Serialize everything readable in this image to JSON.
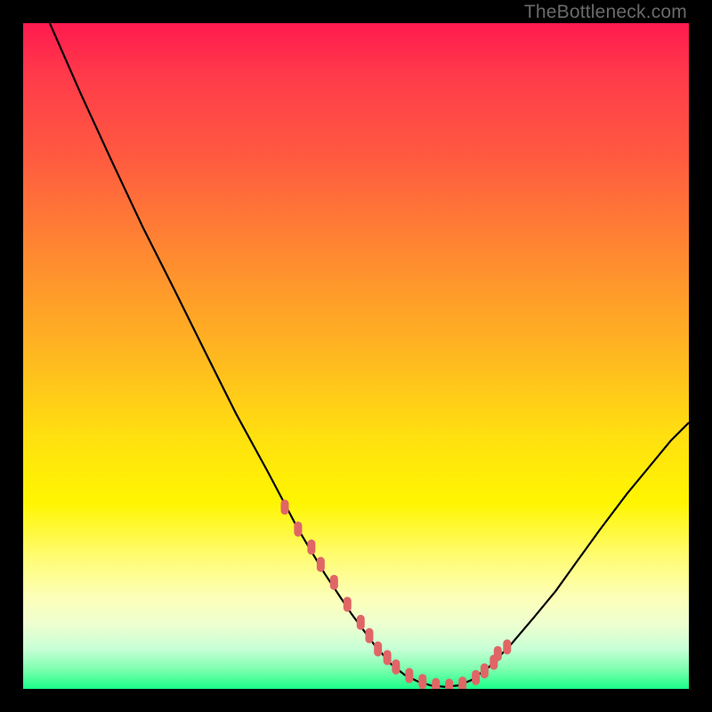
{
  "watermark": "TheBottleneck.com",
  "chart_data": {
    "type": "line",
    "title": "",
    "xlabel": "",
    "ylabel": "",
    "xlim": [
      0,
      100
    ],
    "ylim": [
      0,
      100
    ],
    "x": [
      4.0,
      8.7,
      13.3,
      18.0,
      22.7,
      27.3,
      32.0,
      36.7,
      41.3,
      45.3,
      49.3,
      52.7,
      55.3,
      57.3,
      59.3,
      61.3,
      63.3,
      65.3,
      67.3,
      70.0,
      73.3,
      76.7,
      80.0,
      83.3,
      86.7,
      90.7,
      94.0,
      97.3,
      100.0
    ],
    "values": [
      100.0,
      89.3,
      79.3,
      69.3,
      60.0,
      50.7,
      41.3,
      32.7,
      24.0,
      17.3,
      11.3,
      6.7,
      3.7,
      2.1,
      1.1,
      0.5,
      0.3,
      0.5,
      1.3,
      3.3,
      6.7,
      10.7,
      14.7,
      19.3,
      24.0,
      29.3,
      33.3,
      37.3,
      40.0
    ],
    "trough_markers_x": [
      39.3,
      41.3,
      43.3,
      44.7,
      46.7,
      48.7,
      50.7,
      52.0,
      53.3,
      54.7,
      56.0,
      58.0,
      60.0,
      62.0,
      64.0,
      66.0,
      68.0,
      69.3,
      70.7,
      71.3,
      72.7
    ],
    "trough_markers_y": [
      27.3,
      24.0,
      21.3,
      18.7,
      16.0,
      12.7,
      10.0,
      8.0,
      6.0,
      4.7,
      3.3,
      2.0,
      1.1,
      0.5,
      0.4,
      0.7,
      1.7,
      2.7,
      4.0,
      5.3,
      6.3
    ],
    "marker_color": "#e06666",
    "line_color": "#000000"
  }
}
